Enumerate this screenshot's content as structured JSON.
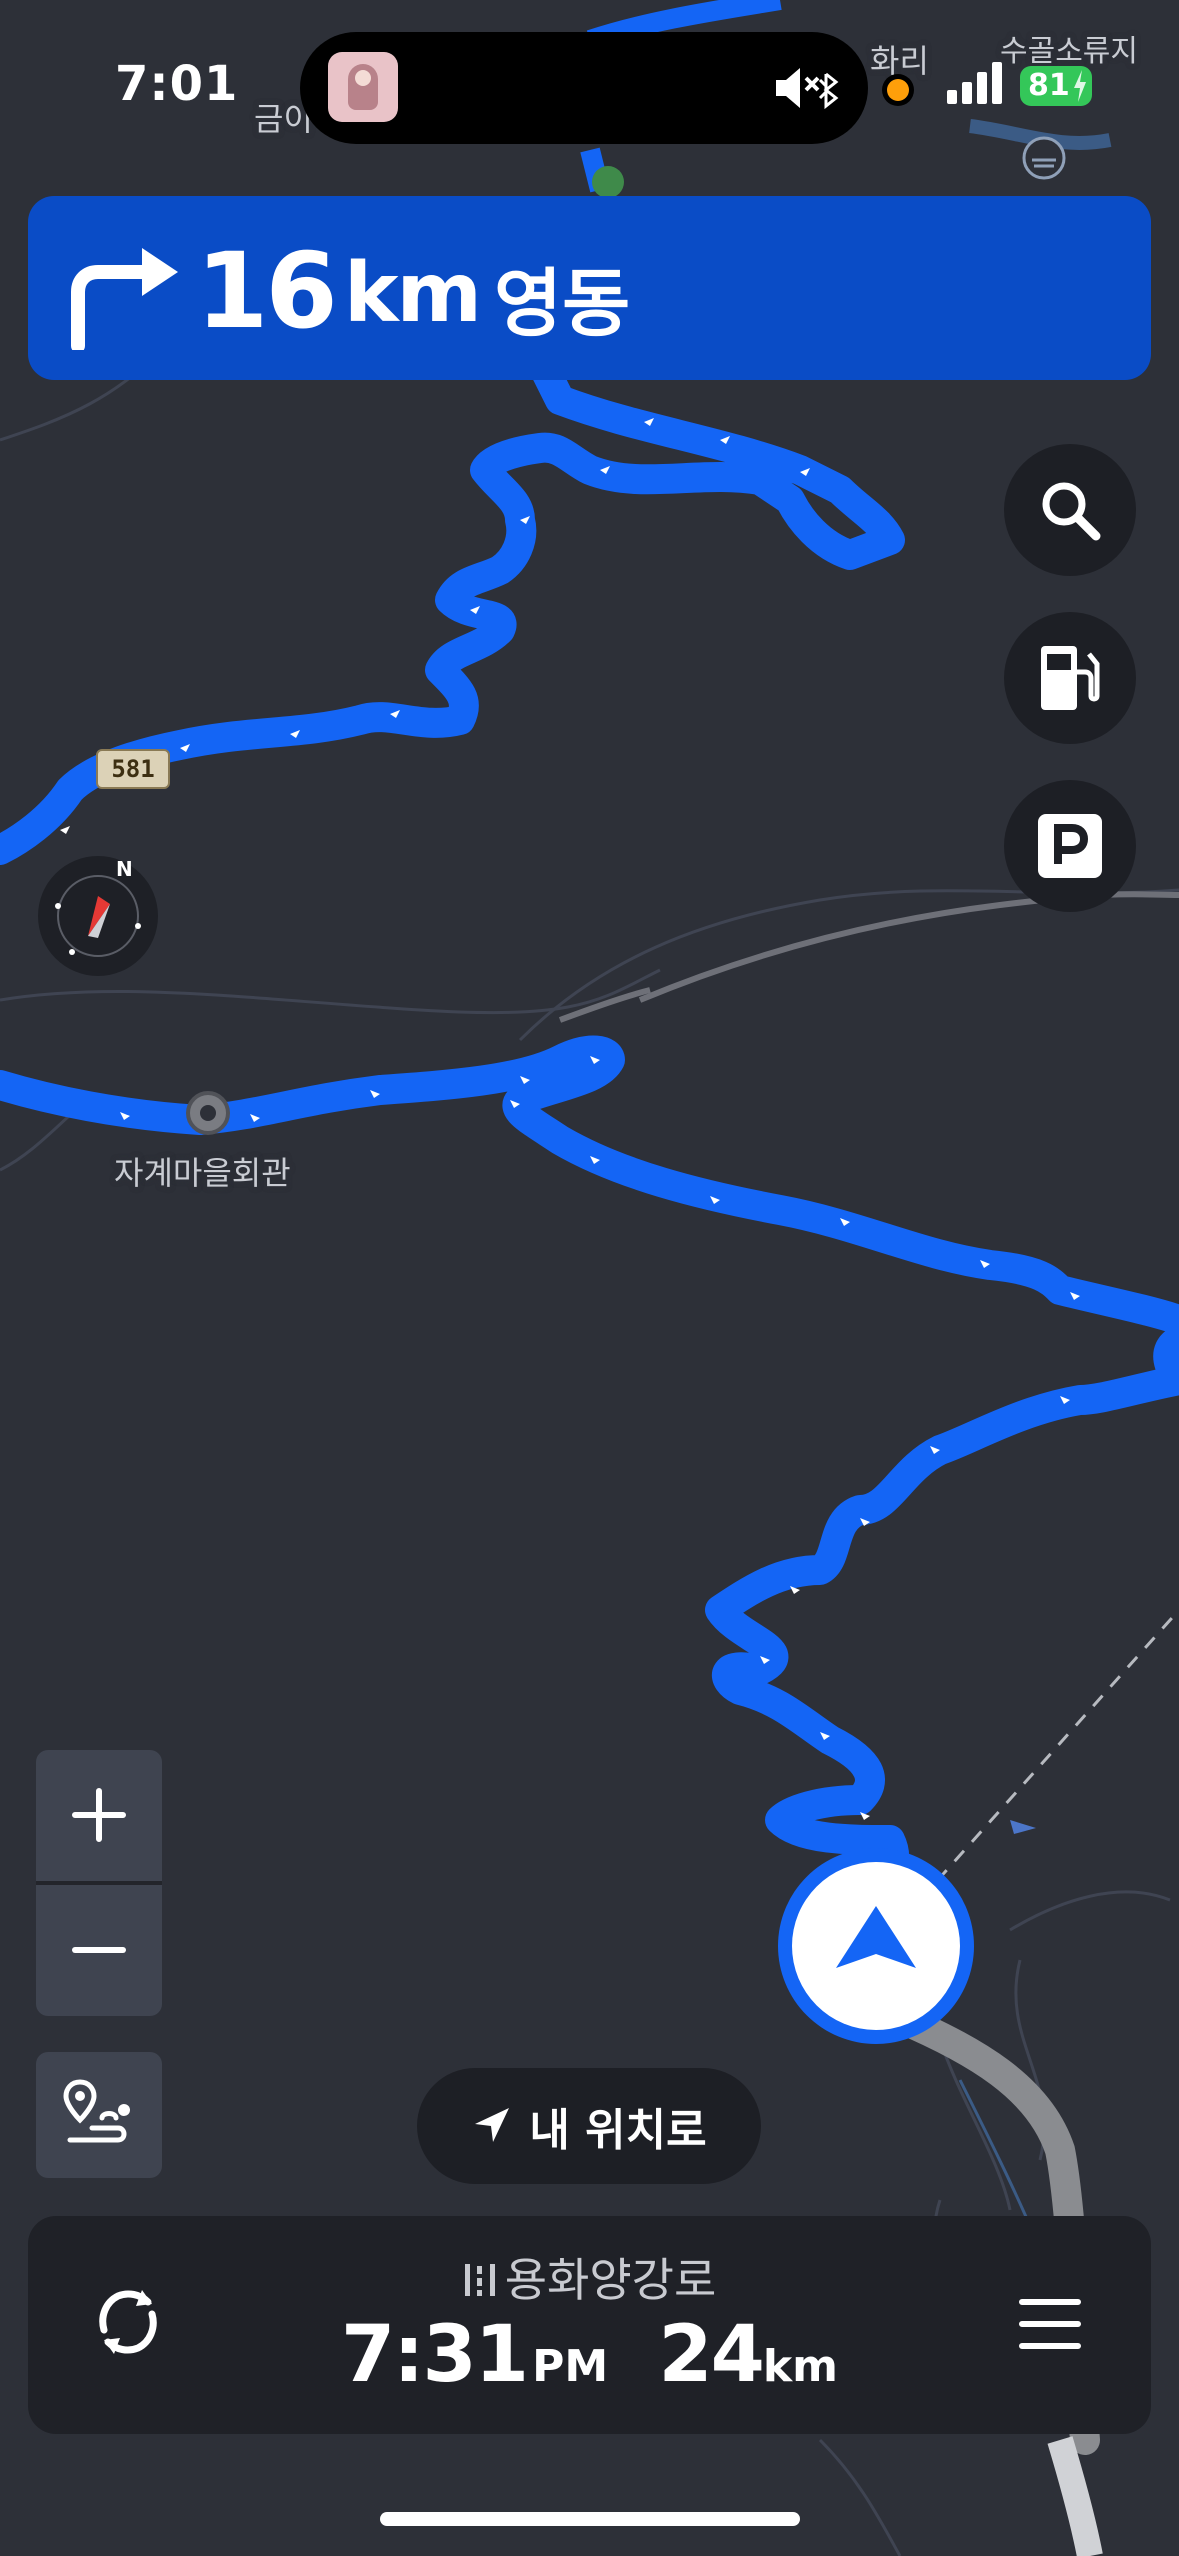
{
  "status": {
    "time": "7:01",
    "battery": "81"
  },
  "map": {
    "labels": [
      "금이",
      "화리",
      "수골소류지",
      "자계마을회관"
    ],
    "route_number": "581",
    "compass_letter": "N"
  },
  "nav": {
    "distance": "16",
    "unit": "km",
    "destination": "영동",
    "turn": "right-turn-arrow-icon"
  },
  "my_location_label": "내 위치로",
  "bottom": {
    "road_name": "용화양강로",
    "eta_time": "7:31",
    "eta_period": "PM",
    "remaining_distance": "24",
    "remaining_unit": "km"
  },
  "colors": {
    "route": "#1465f5",
    "banner": "#0a4cc6",
    "map_bg": "#2d3038",
    "battery": "#34c759"
  }
}
